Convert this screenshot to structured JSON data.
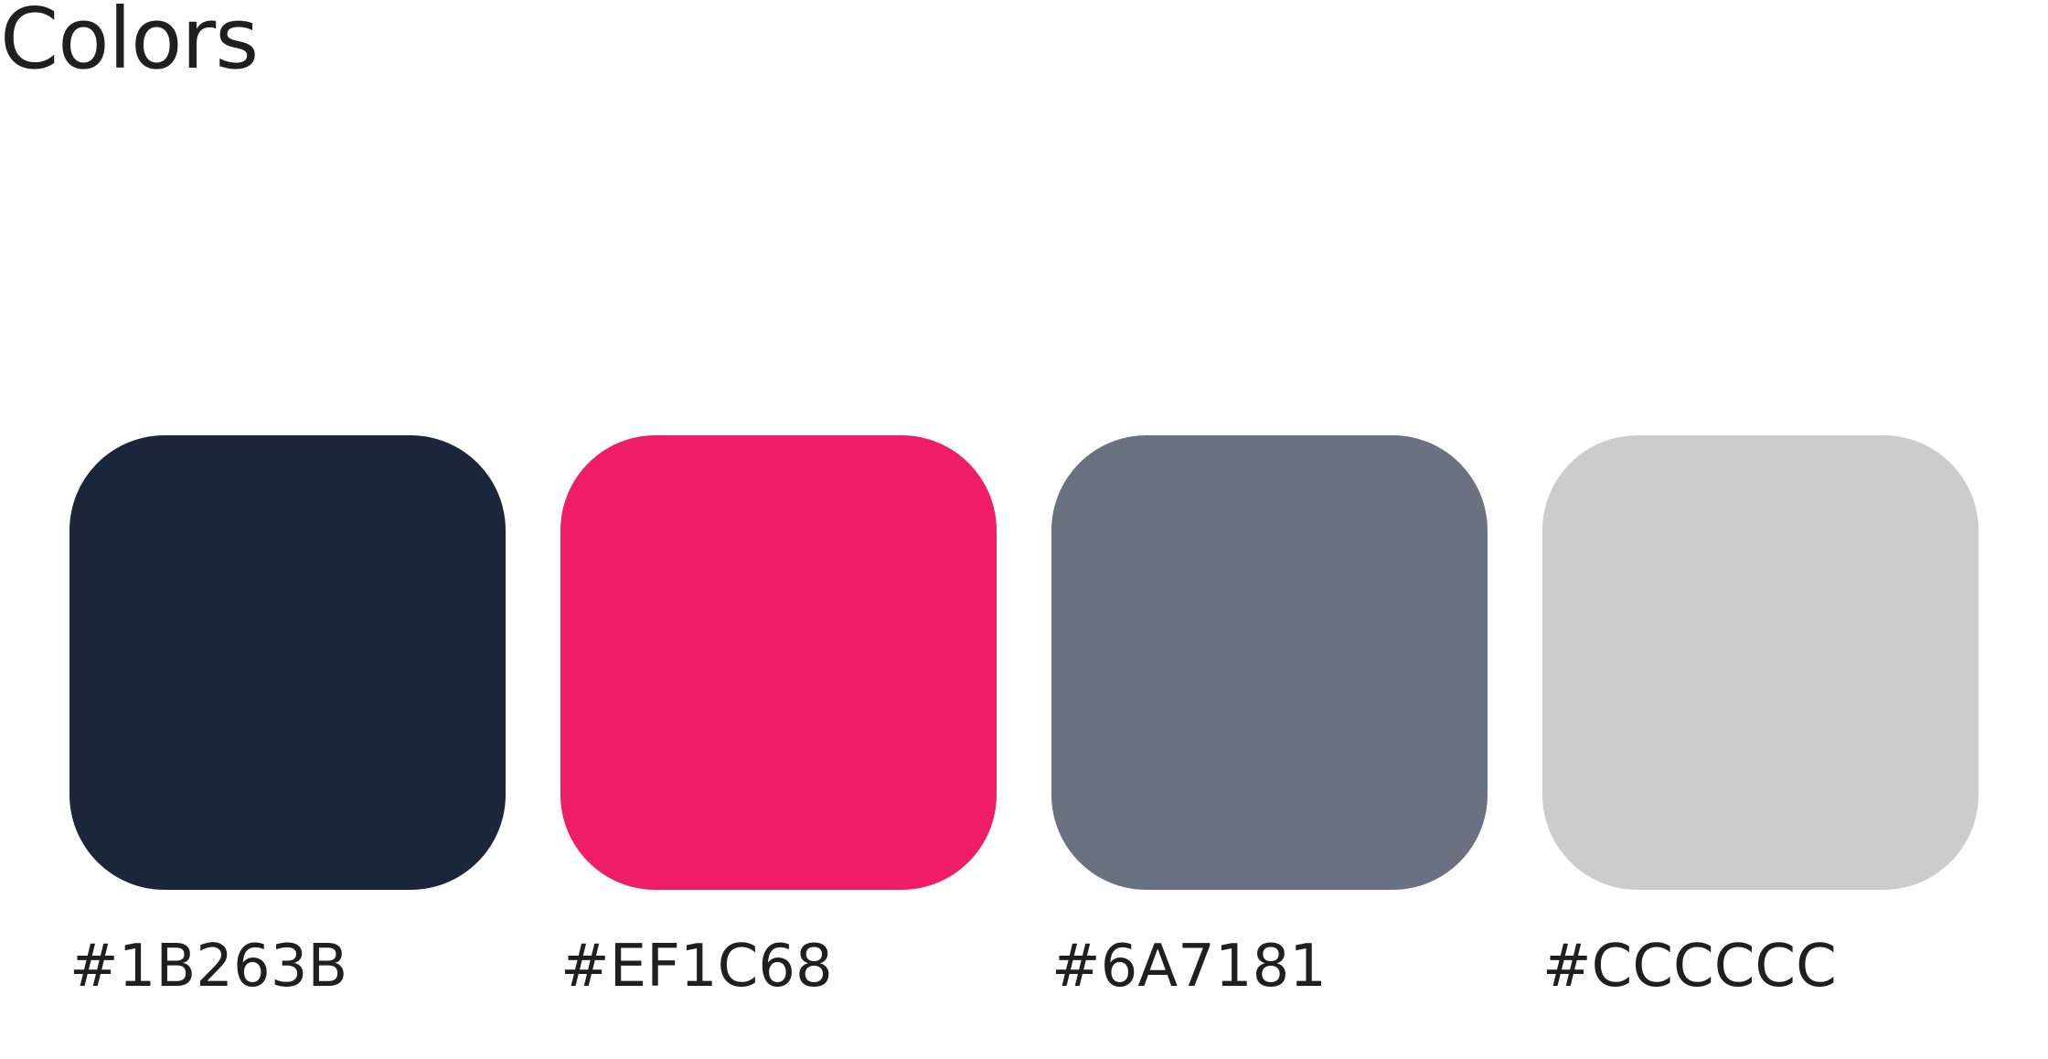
{
  "title": "Colors",
  "colors": [
    {
      "hex": "#1B263B",
      "label": "#1B263B"
    },
    {
      "hex": "#EF1C68",
      "label": "#EF1C68"
    },
    {
      "hex": "#6A7181",
      "label": "#6A7181"
    },
    {
      "hex": "#CCCCCC",
      "label": "#CCCCCC"
    }
  ]
}
